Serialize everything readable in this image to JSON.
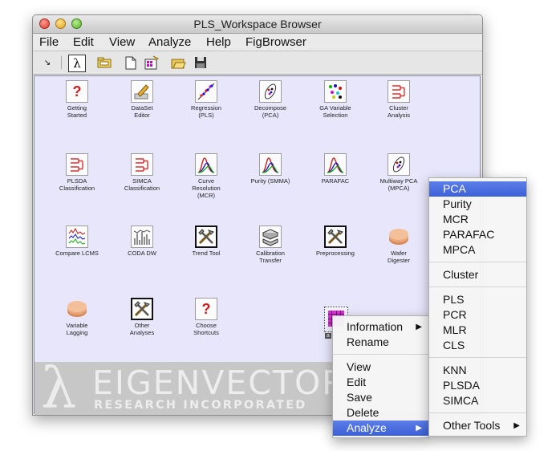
{
  "window": {
    "title": "PLS_Workspace Browser"
  },
  "menubar": [
    "File",
    "Edit",
    "View",
    "Analyze",
    "Help",
    "FigBrowser"
  ],
  "toolbar": {
    "icons": [
      "resize-arrow-icon",
      "lambda-icon",
      "folder-icon",
      "new-document-icon",
      "load-data-icon",
      "open-folder-icon",
      "save-disk-icon"
    ]
  },
  "workspace_items": [
    {
      "label": "Getting\nStarted",
      "icon": "question-icon"
    },
    {
      "label": "DataSet\nEditor",
      "icon": "pencil-icon"
    },
    {
      "label": "Regression\n(PLS)",
      "icon": "regression-scatter-icon"
    },
    {
      "label": "Decompose\n(PCA)",
      "icon": "pca-ellipse-icon"
    },
    {
      "label": "GA Variable\nSelection",
      "icon": "ga-selection-icon"
    },
    {
      "label": "Cluster\nAnalysis",
      "icon": "dendrogram-icon"
    },
    {
      "label": "PLSDA\nClassification",
      "icon": "dendrogram-icon"
    },
    {
      "label": "SIMCA\nClassification",
      "icon": "dendrogram-icon"
    },
    {
      "label": "Curve\nResolution\n(MCR)",
      "icon": "curve-peaks-icon"
    },
    {
      "label": "Purity (SMMA)",
      "icon": "curve-peaks-icon"
    },
    {
      "label": "PARAFAC",
      "icon": "curve-peaks-icon"
    },
    {
      "label": "Multiway PCA\n(MPCA)",
      "icon": "pca-ellipse-icon"
    },
    {
      "label": "Compare LCMS",
      "icon": "spectra-icon"
    },
    {
      "label": "CODA DW",
      "icon": "spectra-bars-icon"
    },
    {
      "label": "Trend Tool",
      "icon": "tools-icon"
    },
    {
      "label": "Calibration\nTransfer",
      "icon": "transfer-icon"
    },
    {
      "label": "Preprocessing",
      "icon": "tools-icon"
    },
    {
      "label": "Wafer\nDigester",
      "icon": "wafer-icon"
    },
    {
      "label": "Variable\nLagging",
      "icon": "wafer-icon"
    },
    {
      "label": "Other\nAnalyses",
      "icon": "tools-icon"
    },
    {
      "label": "Choose\nShortcuts",
      "icon": "question-icon"
    }
  ],
  "logo": {
    "name": "EIGENVECTOR",
    "sub": "RESEARCH INCORPORATED"
  },
  "selected_item": {
    "label": "a"
  },
  "context_menu": {
    "items": [
      "Information",
      "Rename",
      "View",
      "Edit",
      "Save",
      "Delete",
      "Analyze"
    ],
    "highlighted": "Analyze"
  },
  "analyze_submenu": {
    "items": [
      "PCA",
      "Purity",
      "MCR",
      "PARAFAC",
      "MPCA",
      "Cluster",
      "PLS",
      "PCR",
      "MLR",
      "CLS",
      "KNN",
      "PLSDA",
      "SIMCA",
      "Other Tools"
    ],
    "highlighted": "PCA"
  },
  "colors": {
    "highlight": "#3c60d8",
    "canvas": "#e8e6fa",
    "selected_icon": "#e22ae2"
  }
}
